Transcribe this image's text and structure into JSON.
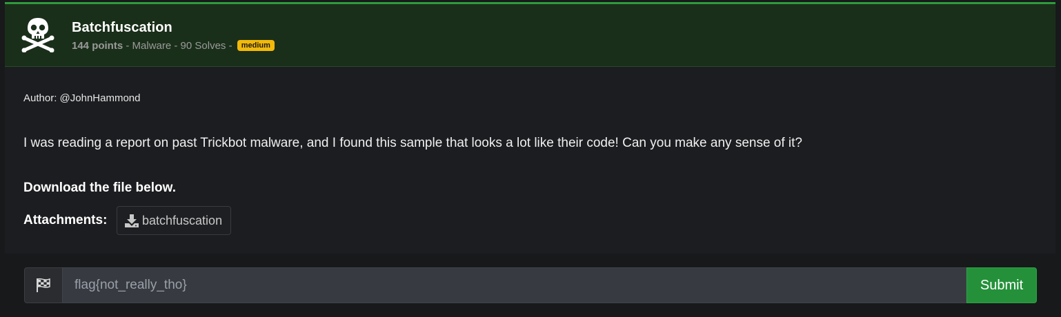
{
  "challenge": {
    "title": "Batchfuscation",
    "points": "144 points",
    "category_sep": " - Malware - ",
    "solves": "90 Solves",
    "solves_sep": " - ",
    "difficulty": "medium",
    "icon": "skull-crossbones-icon"
  },
  "body": {
    "author": "Author: @JohnHammond",
    "description": "I was reading a report on past Trickbot malware, and I found this sample that looks a lot like their code! Can you make any sense of it?",
    "download_text": "Download the file below.",
    "attachments_label": "Attachments:",
    "attachment_name": "batchfuscation",
    "attachment_icon": "download-icon"
  },
  "submission": {
    "flag_icon": "checkered-flag-icon",
    "placeholder": "flag{not_really_tho}",
    "value": "",
    "submit_label": "Submit"
  },
  "colors": {
    "accent_green": "#2e9a3c",
    "header_bg": "#1a2f1a",
    "badge_yellow": "#f2b90a",
    "submit_green": "#24913a"
  }
}
